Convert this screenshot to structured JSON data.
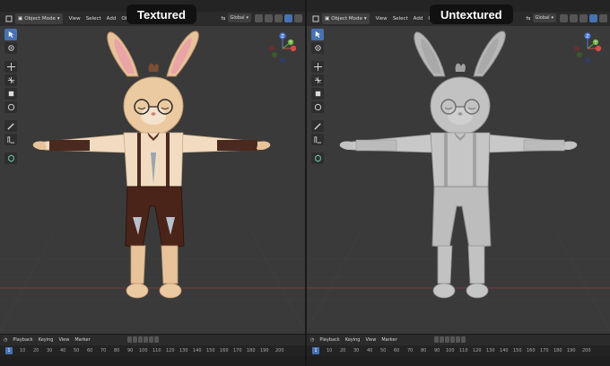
{
  "panels": [
    {
      "badge": "Textured",
      "header": {
        "mode": "Object Mode",
        "menus": [
          "View",
          "Select",
          "Add",
          "Object"
        ],
        "transform": "Global"
      },
      "timeline": {
        "menus": [
          "Playback",
          "Keying",
          "View",
          "Marker"
        ],
        "current_frame": "1",
        "ticks": [
          "10",
          "20",
          "30",
          "40",
          "50",
          "60",
          "70",
          "80",
          "90",
          "100",
          "110",
          "120",
          "130",
          "140",
          "150",
          "160",
          "170",
          "180",
          "190",
          "200"
        ]
      }
    },
    {
      "badge": "Untextured",
      "header": {
        "mode": "Object Mode",
        "menus": [
          "View",
          "Select",
          "Add",
          "Object"
        ],
        "transform": "Global"
      },
      "timeline": {
        "menus": [
          "Playback",
          "Keying",
          "View",
          "Marker"
        ],
        "current_frame": "1",
        "ticks": [
          "10",
          "20",
          "30",
          "40",
          "50",
          "60",
          "70",
          "80",
          "90",
          "100",
          "110",
          "120",
          "130",
          "140",
          "150",
          "160",
          "170",
          "180",
          "190",
          "200"
        ]
      }
    }
  ],
  "gizmo": {
    "z": "Z",
    "y": "Y"
  },
  "colors": {
    "active_blue": "#4772b3",
    "x_axis": "#d94a4a",
    "y_axis": "#6cb040",
    "z_axis": "#4a78d9"
  }
}
